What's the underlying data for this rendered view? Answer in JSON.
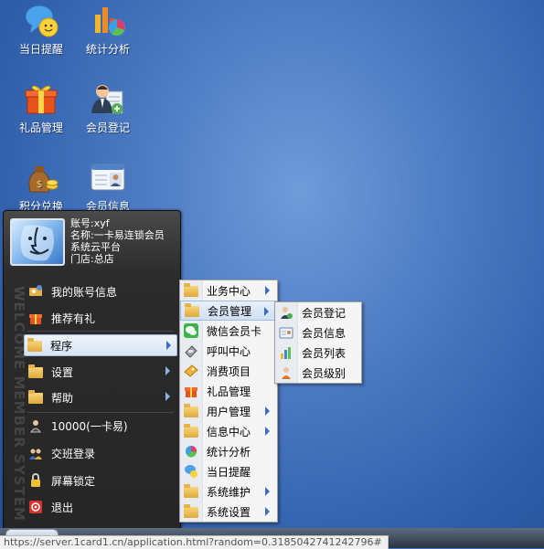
{
  "desktop": {
    "icons": [
      {
        "label": "当日提醒",
        "icon": "reminder-bubble-icon"
      },
      {
        "label": "统计分析",
        "icon": "statistics-chart-icon"
      },
      {
        "label": "礼品管理",
        "icon": "gift-icon"
      },
      {
        "label": "会员登记",
        "icon": "member-register-icon"
      },
      {
        "label": "积分兑换",
        "icon": "points-bag-icon"
      },
      {
        "label": "会员信息",
        "icon": "member-card-icon"
      }
    ]
  },
  "start_menu": {
    "user": {
      "account": "账号:xyf",
      "name": "名称:一卡易连锁会员",
      "system": "系统云平台",
      "store": "门店:总店"
    },
    "side_text": "WELCOME MEMBER SYSTEM",
    "items": [
      {
        "label": "我的账号信息",
        "icon": "account-icon"
      },
      {
        "label": "推荐有礼",
        "icon": "gift-icon"
      },
      {
        "label": "程序",
        "icon": "folder-icon",
        "has_submenu": true,
        "active": true
      },
      {
        "label": "设置",
        "icon": "folder-icon",
        "has_submenu": true
      },
      {
        "label": "帮助",
        "icon": "folder-icon",
        "has_submenu": true
      },
      {
        "label": "10000(一卡易)",
        "icon": "user-icon"
      },
      {
        "label": "交班登录",
        "icon": "shift-users-icon"
      },
      {
        "label": "屏幕锁定",
        "icon": "lock-icon"
      },
      {
        "label": "退出",
        "icon": "exit-icon"
      }
    ]
  },
  "programs_menu": {
    "items": [
      {
        "label": "业务中心",
        "icon": "folder-icon",
        "has_submenu": true
      },
      {
        "label": "会员管理",
        "icon": "folder-icon",
        "has_submenu": true,
        "active": true
      },
      {
        "label": "微信会员卡",
        "icon": "wechat-icon"
      },
      {
        "label": "呼叫中心",
        "icon": "phone-icon"
      },
      {
        "label": "消费项目",
        "icon": "ticket-icon"
      },
      {
        "label": "礼品管理",
        "icon": "gift-icon"
      },
      {
        "label": "用户管理",
        "icon": "folder-icon",
        "has_submenu": true
      },
      {
        "label": "信息中心",
        "icon": "folder-icon",
        "has_submenu": true
      },
      {
        "label": "统计分析",
        "icon": "statistics-icon"
      },
      {
        "label": "当日提醒",
        "icon": "reminder-icon"
      },
      {
        "label": "系统维护",
        "icon": "folder-icon",
        "has_submenu": true
      },
      {
        "label": "系统设置",
        "icon": "folder-icon",
        "has_submenu": true
      }
    ]
  },
  "member_menu": {
    "items": [
      {
        "label": "会员登记",
        "icon": "member-register-icon"
      },
      {
        "label": "会员信息",
        "icon": "member-card-icon"
      },
      {
        "label": "会员列表",
        "icon": "member-list-icon"
      },
      {
        "label": "会员级别",
        "icon": "member-level-icon"
      }
    ]
  },
  "status_bar": {
    "url": "https://server.1card1.cn/application.html?random=0.3185042741242796#"
  },
  "colors": {
    "desktop": "#3e6db8",
    "menu_dark": "#2b2b2b",
    "submenu_bg": "#f5f5f5",
    "highlight": "#cfe0f5"
  }
}
